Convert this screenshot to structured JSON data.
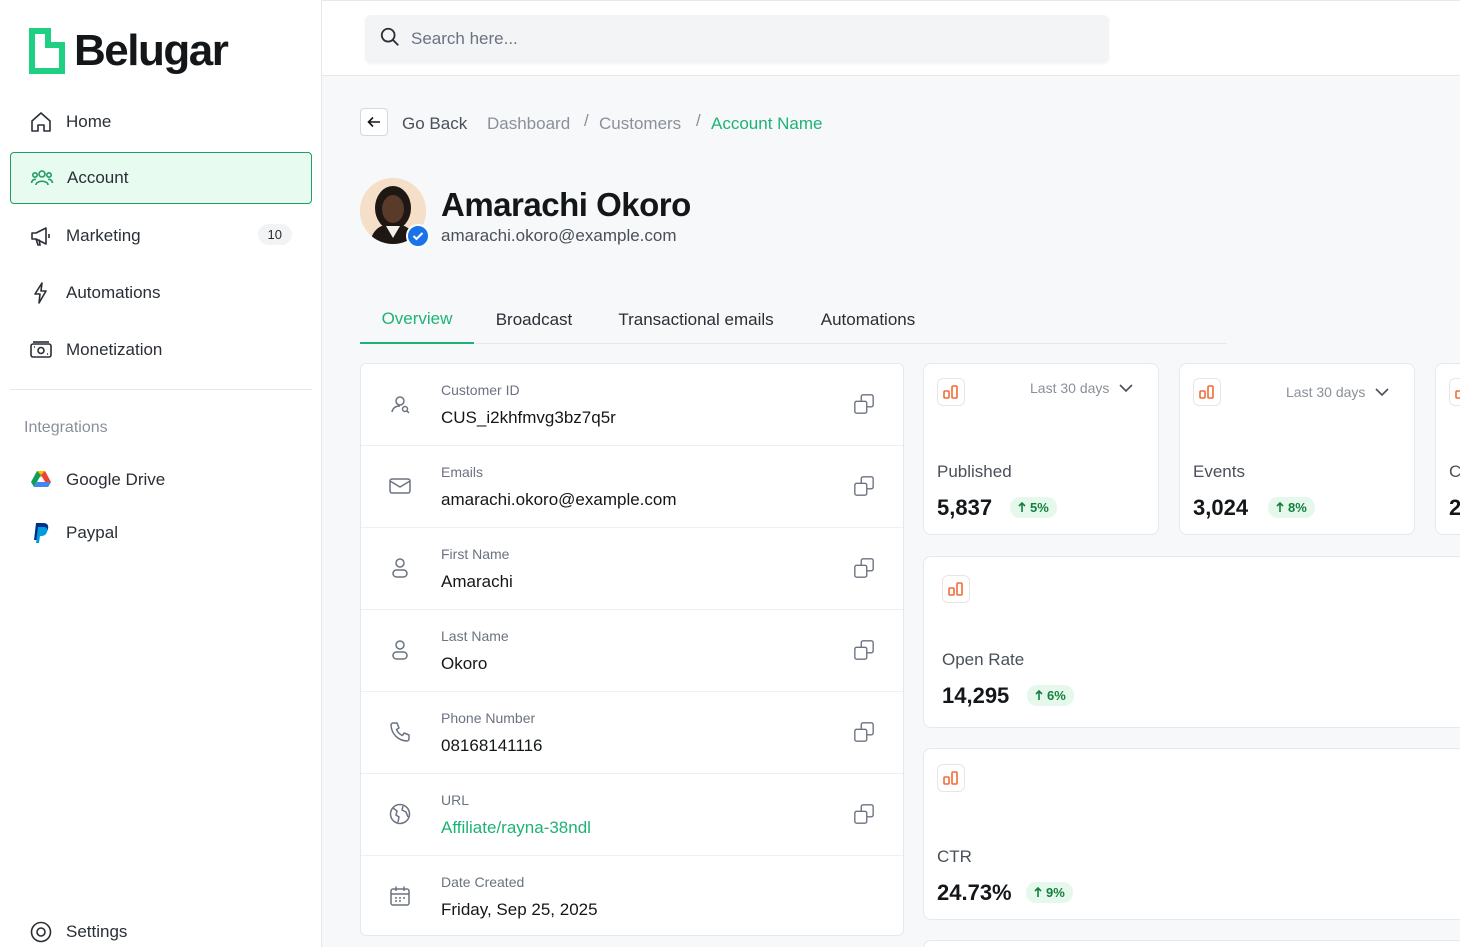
{
  "brand": {
    "name": "Belugar",
    "accent": "#1fb276"
  },
  "sidebar": {
    "items": [
      {
        "label": "Home",
        "icon": "home-icon"
      },
      {
        "label": "Account",
        "icon": "users-icon"
      },
      {
        "label": "Marketing",
        "icon": "megaphone-icon",
        "badge": "10"
      },
      {
        "label": "Automations",
        "icon": "bolt-icon"
      },
      {
        "label": "Monetization",
        "icon": "money-icon"
      }
    ],
    "integrations_label": "Integrations",
    "integrations": [
      {
        "label": "Google Drive",
        "icon": "google-drive-icon"
      },
      {
        "label": "Paypal",
        "icon": "paypal-icon"
      }
    ],
    "settings_label": "Settings"
  },
  "search": {
    "placeholder": "Search here..."
  },
  "breadcrumb": {
    "go_back": "Go Back",
    "items": [
      "Dashboard",
      "Customers",
      "Account Name"
    ],
    "separator": "/"
  },
  "profile": {
    "name": "Amarachi Okoro",
    "email": "amarachi.okoro@example.com"
  },
  "tabs": [
    "Overview",
    "Broadcast",
    "Transactional emails",
    "Automations"
  ],
  "details": [
    {
      "label": "Customer ID",
      "value": "CUS_i2khfmvg3bz7q5r",
      "icon": "user-search-icon"
    },
    {
      "label": "Emails",
      "value": "amarachi.okoro@example.com",
      "icon": "mail-icon"
    },
    {
      "label": "First Name",
      "value": "Amarachi",
      "icon": "person-icon"
    },
    {
      "label": "Last Name",
      "value": "Okoro",
      "icon": "person-icon"
    },
    {
      "label": "Phone Number",
      "value": "08168141116",
      "icon": "phone-icon"
    },
    {
      "label": "URL",
      "value": "Affiliate/rayna-38ndl",
      "icon": "globe-icon"
    },
    {
      "label": "Date Created",
      "value": "Friday, Sep 25, 2025",
      "icon": "calendar-icon"
    }
  ],
  "stats": [
    {
      "label": "Published",
      "value": "5,837",
      "delta": "5%",
      "period": "Last 30 days"
    },
    {
      "label": "Events",
      "value": "3,024",
      "delta": "8%",
      "period": "Last 30 days"
    },
    {
      "label": "C",
      "value": "2"
    },
    {
      "label": "Open Rate",
      "value": "14,295",
      "delta": "6%"
    },
    {
      "label": "CTR",
      "value": "24.73%",
      "delta": "9%"
    }
  ]
}
